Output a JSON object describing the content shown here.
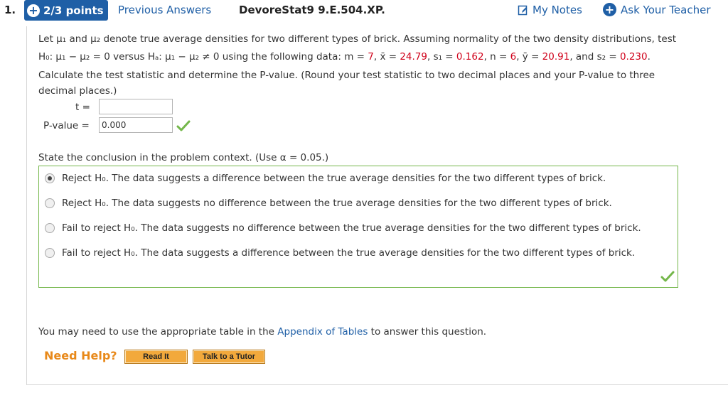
{
  "header": {
    "question_number": "1.",
    "points": "2/3 points",
    "previous_answers": "Previous Answers",
    "question_id": "DevoreStat9 9.E.504.XP.",
    "my_notes": "My Notes",
    "ask_teacher": "Ask Your Teacher"
  },
  "problem": {
    "line1": "Let μ₁ and μ₂ denote true average densities for two different types of brick. Assuming normality of the two density distributions, test",
    "hyp_h0": "H₀: μ₁ − μ₂ = 0 versus Hₐ: μ₁ − μ₂ ≠ 0 using the following data: ",
    "m_label": "m = ",
    "m_value": "7",
    "xbar_label": ", x̄ = ",
    "xbar_value": "24.79",
    "s1_label": ", s₁ = ",
    "s1_value": "0.162",
    "n_label": ", n = ",
    "n_value": "6",
    "ybar_label": ", ȳ = ",
    "ybar_value": "20.91",
    "s2_label": ", and s₂ = ",
    "s2_value": "0.230",
    "s2_end": ".",
    "instructions_line1": "Calculate the test statistic and determine the P-value. (Round your test statistic to two decimal places and your P-value to three",
    "instructions_line2": "decimal places.)"
  },
  "inputs": {
    "t_label": "t =",
    "t_value": "",
    "pvalue_label": "P-value =",
    "pvalue_value": "0.000"
  },
  "conclusion": {
    "prompt": "State the conclusion in the problem context. (Use α = 0.05.)",
    "options": [
      {
        "label": "Reject H₀. The data suggests a difference between the true average densities for the two different types of brick.",
        "selected": true
      },
      {
        "label": "Reject H₀. The data suggests no difference between the true average densities for the two different types of brick.",
        "selected": false
      },
      {
        "label": "Fail to reject H₀. The data suggests no difference between the true average densities for the two different types of brick.",
        "selected": false
      },
      {
        "label": "Fail to reject H₀. The data suggests a difference between the true average densities for the two different types of brick.",
        "selected": false
      }
    ]
  },
  "footer": {
    "appendix_pre": "You may need to use the appropriate table in the ",
    "appendix_link": "Appendix of Tables",
    "appendix_post": " to answer this question.",
    "need_help": "Need Help?",
    "read_it": "Read It",
    "talk_tutor": "Talk to a Tutor"
  },
  "colors": {
    "accent_blue": "#1f5fa6",
    "value_red": "#d0021b",
    "correct_green": "#74b74a",
    "help_orange": "#f2a93c"
  },
  "icons": [
    "plus-circle-icon",
    "notes-icon",
    "checkmark-icon",
    "radio-icon"
  ]
}
